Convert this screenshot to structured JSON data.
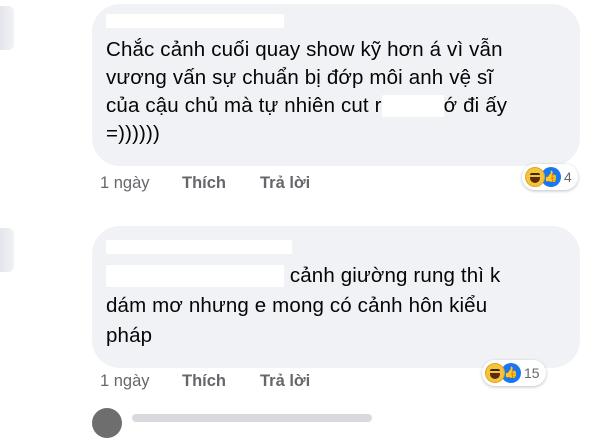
{
  "comments": [
    {
      "lines": [
        "Chắc cảnh cuối quay show kỹ hơn á vì vẫn",
        "vương vấn sự chuẩn bị đớp môi anh vệ sĩ",
        "của cậu chủ mà tự nhiên cut",
        "=))))))"
      ],
      "line3_after_redaction": "đi ấy",
      "redacted_fragment_visible": "r",
      "redacted_fragment_visible_2": "ớ",
      "time": "1 ngày",
      "like_label": "Thích",
      "reply_label": "Trả lời",
      "reaction_count": "4",
      "reaction_icons": [
        "haha-icon",
        "like-icon"
      ]
    },
    {
      "lines": [
        "cảnh giường rung thì k",
        "dám mơ nhưng e mong có cảnh hôn kiểu",
        "pháp"
      ],
      "time": "1 ngày",
      "like_label": "Thích",
      "reply_label": "Trả lời",
      "reaction_count": "15",
      "reaction_icons": [
        "haha-icon",
        "like-icon"
      ]
    }
  ],
  "colors": {
    "bubble": "#f0f2f5",
    "meta_text": "#65676b",
    "like_blue": "#1877f2",
    "haha_yellow": "#f7c33b"
  }
}
